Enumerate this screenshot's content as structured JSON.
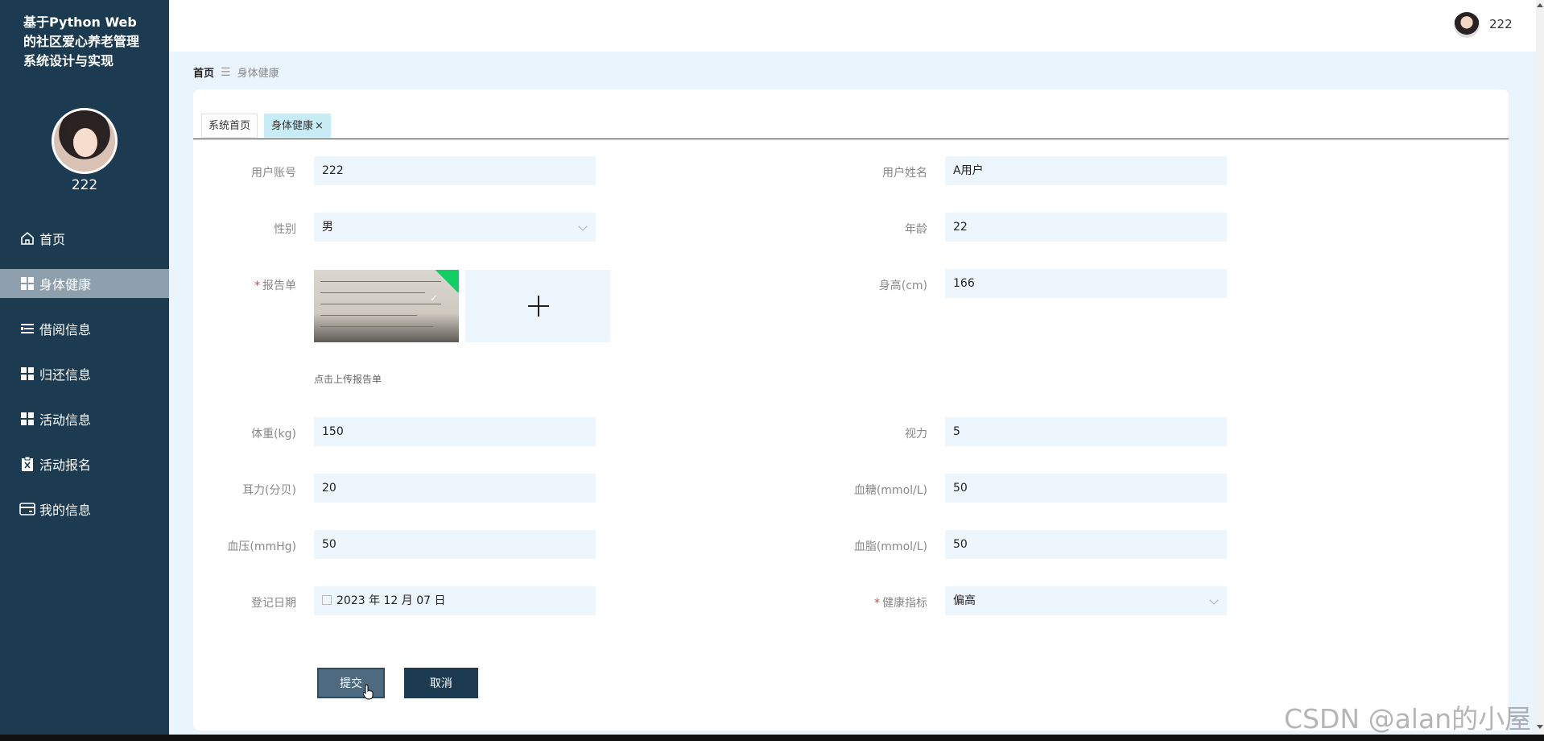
{
  "app": {
    "title": "基于Python Web的社区爱心养老管理系统设计与实现",
    "username": "222"
  },
  "sidebar": {
    "items": [
      {
        "label": "首页",
        "icon": "home-icon"
      },
      {
        "label": "身体健康",
        "icon": "grid-icon",
        "active": true
      },
      {
        "label": "借阅信息",
        "icon": "list-icon"
      },
      {
        "label": "归还信息",
        "icon": "grid-icon"
      },
      {
        "label": "活动信息",
        "icon": "grid-icon"
      },
      {
        "label": "活动报名",
        "icon": "clipboard-icon"
      },
      {
        "label": "我的信息",
        "icon": "card-icon"
      }
    ]
  },
  "topbar": {
    "username": "222"
  },
  "breadcrumb": {
    "home": "首页",
    "separator": "☰",
    "current": "身体健康"
  },
  "tabs": [
    {
      "label": "系统首页"
    },
    {
      "label": "身体健康",
      "active": true,
      "close": "×"
    }
  ],
  "form": {
    "account": {
      "label": "用户账号",
      "value": "222"
    },
    "name": {
      "label": "用户姓名",
      "value": "A用户"
    },
    "gender": {
      "label": "性别",
      "value": "男"
    },
    "age": {
      "label": "年龄",
      "value": "22"
    },
    "report": {
      "label": "报告单",
      "required": "*",
      "hint": "点击上传报告单",
      "uploaded_check": "✓"
    },
    "height": {
      "label": "身高(cm)",
      "value": "166"
    },
    "weight": {
      "label": "体重(kg)",
      "value": "150"
    },
    "vision": {
      "label": "视力",
      "value": "5"
    },
    "hearing": {
      "label": "耳力(分贝)",
      "value": "20"
    },
    "blood_sugar": {
      "label": "血糖(mmol/L)",
      "value": "50"
    },
    "blood_pressure": {
      "label": "血压(mmHg)",
      "value": "50"
    },
    "blood_lipid": {
      "label": "血脂(mmol/L)",
      "value": "50"
    },
    "reg_date": {
      "label": "登记日期",
      "value": "2023 年 12 月 07 日"
    },
    "health_index": {
      "label": "健康指标",
      "required": "*",
      "value": "偏高"
    }
  },
  "buttons": {
    "submit": "提交",
    "cancel": "取消"
  },
  "watermark": "CSDN @alan的小屋",
  "colors": {
    "sidebar_bg": "#1c3a50",
    "input_bg": "#edf5fd",
    "success": "#13ce66",
    "required": "#e04040"
  }
}
